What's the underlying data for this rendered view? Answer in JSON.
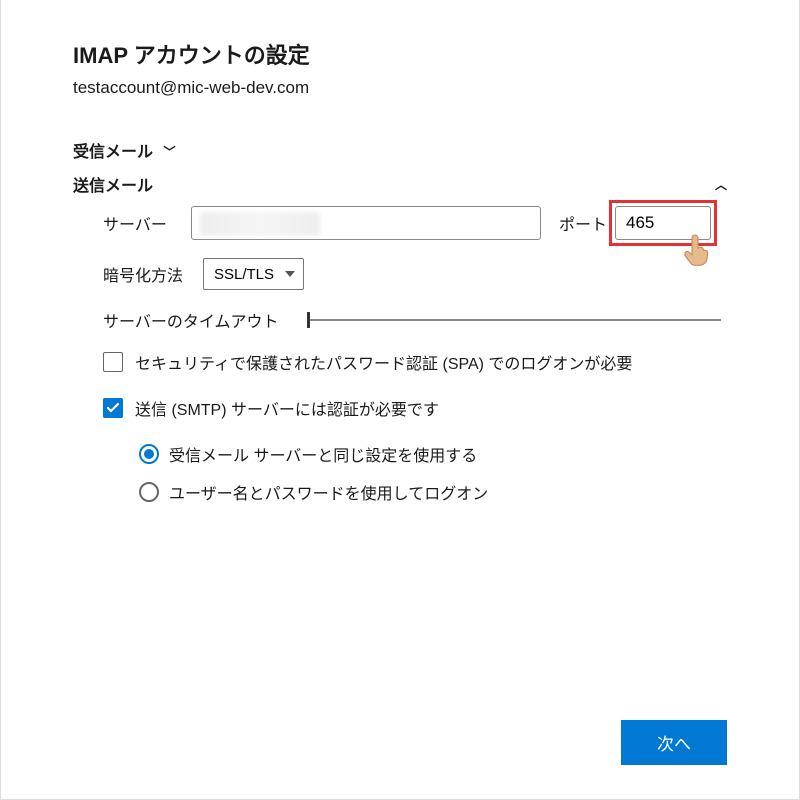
{
  "header": {
    "title": "IMAP アカウントの設定",
    "email": "testaccount@mic-web-dev.com"
  },
  "sections": {
    "incoming_label": "受信メール",
    "outgoing_label": "送信メール"
  },
  "outgoing": {
    "server_label": "サーバー",
    "server_value": "",
    "port_label": "ポート",
    "port_value": "465",
    "encryption_label": "暗号化方法",
    "encryption_value": "SSL/TLS",
    "timeout_label": "サーバーのタイムアウト",
    "spa_label": "セキュリティで保護されたパスワード認証 (SPA) でのログオンが必要",
    "spa_checked": false,
    "auth_required_label": "送信 (SMTP) サーバーには認証が必要です",
    "auth_required_checked": true,
    "radio_same_label": "受信メール サーバーと同じ設定を使用する",
    "radio_user_label": "ユーザー名とパスワードを使用してログオン",
    "radio_selected": "same"
  },
  "footer": {
    "next_label": "次へ"
  }
}
